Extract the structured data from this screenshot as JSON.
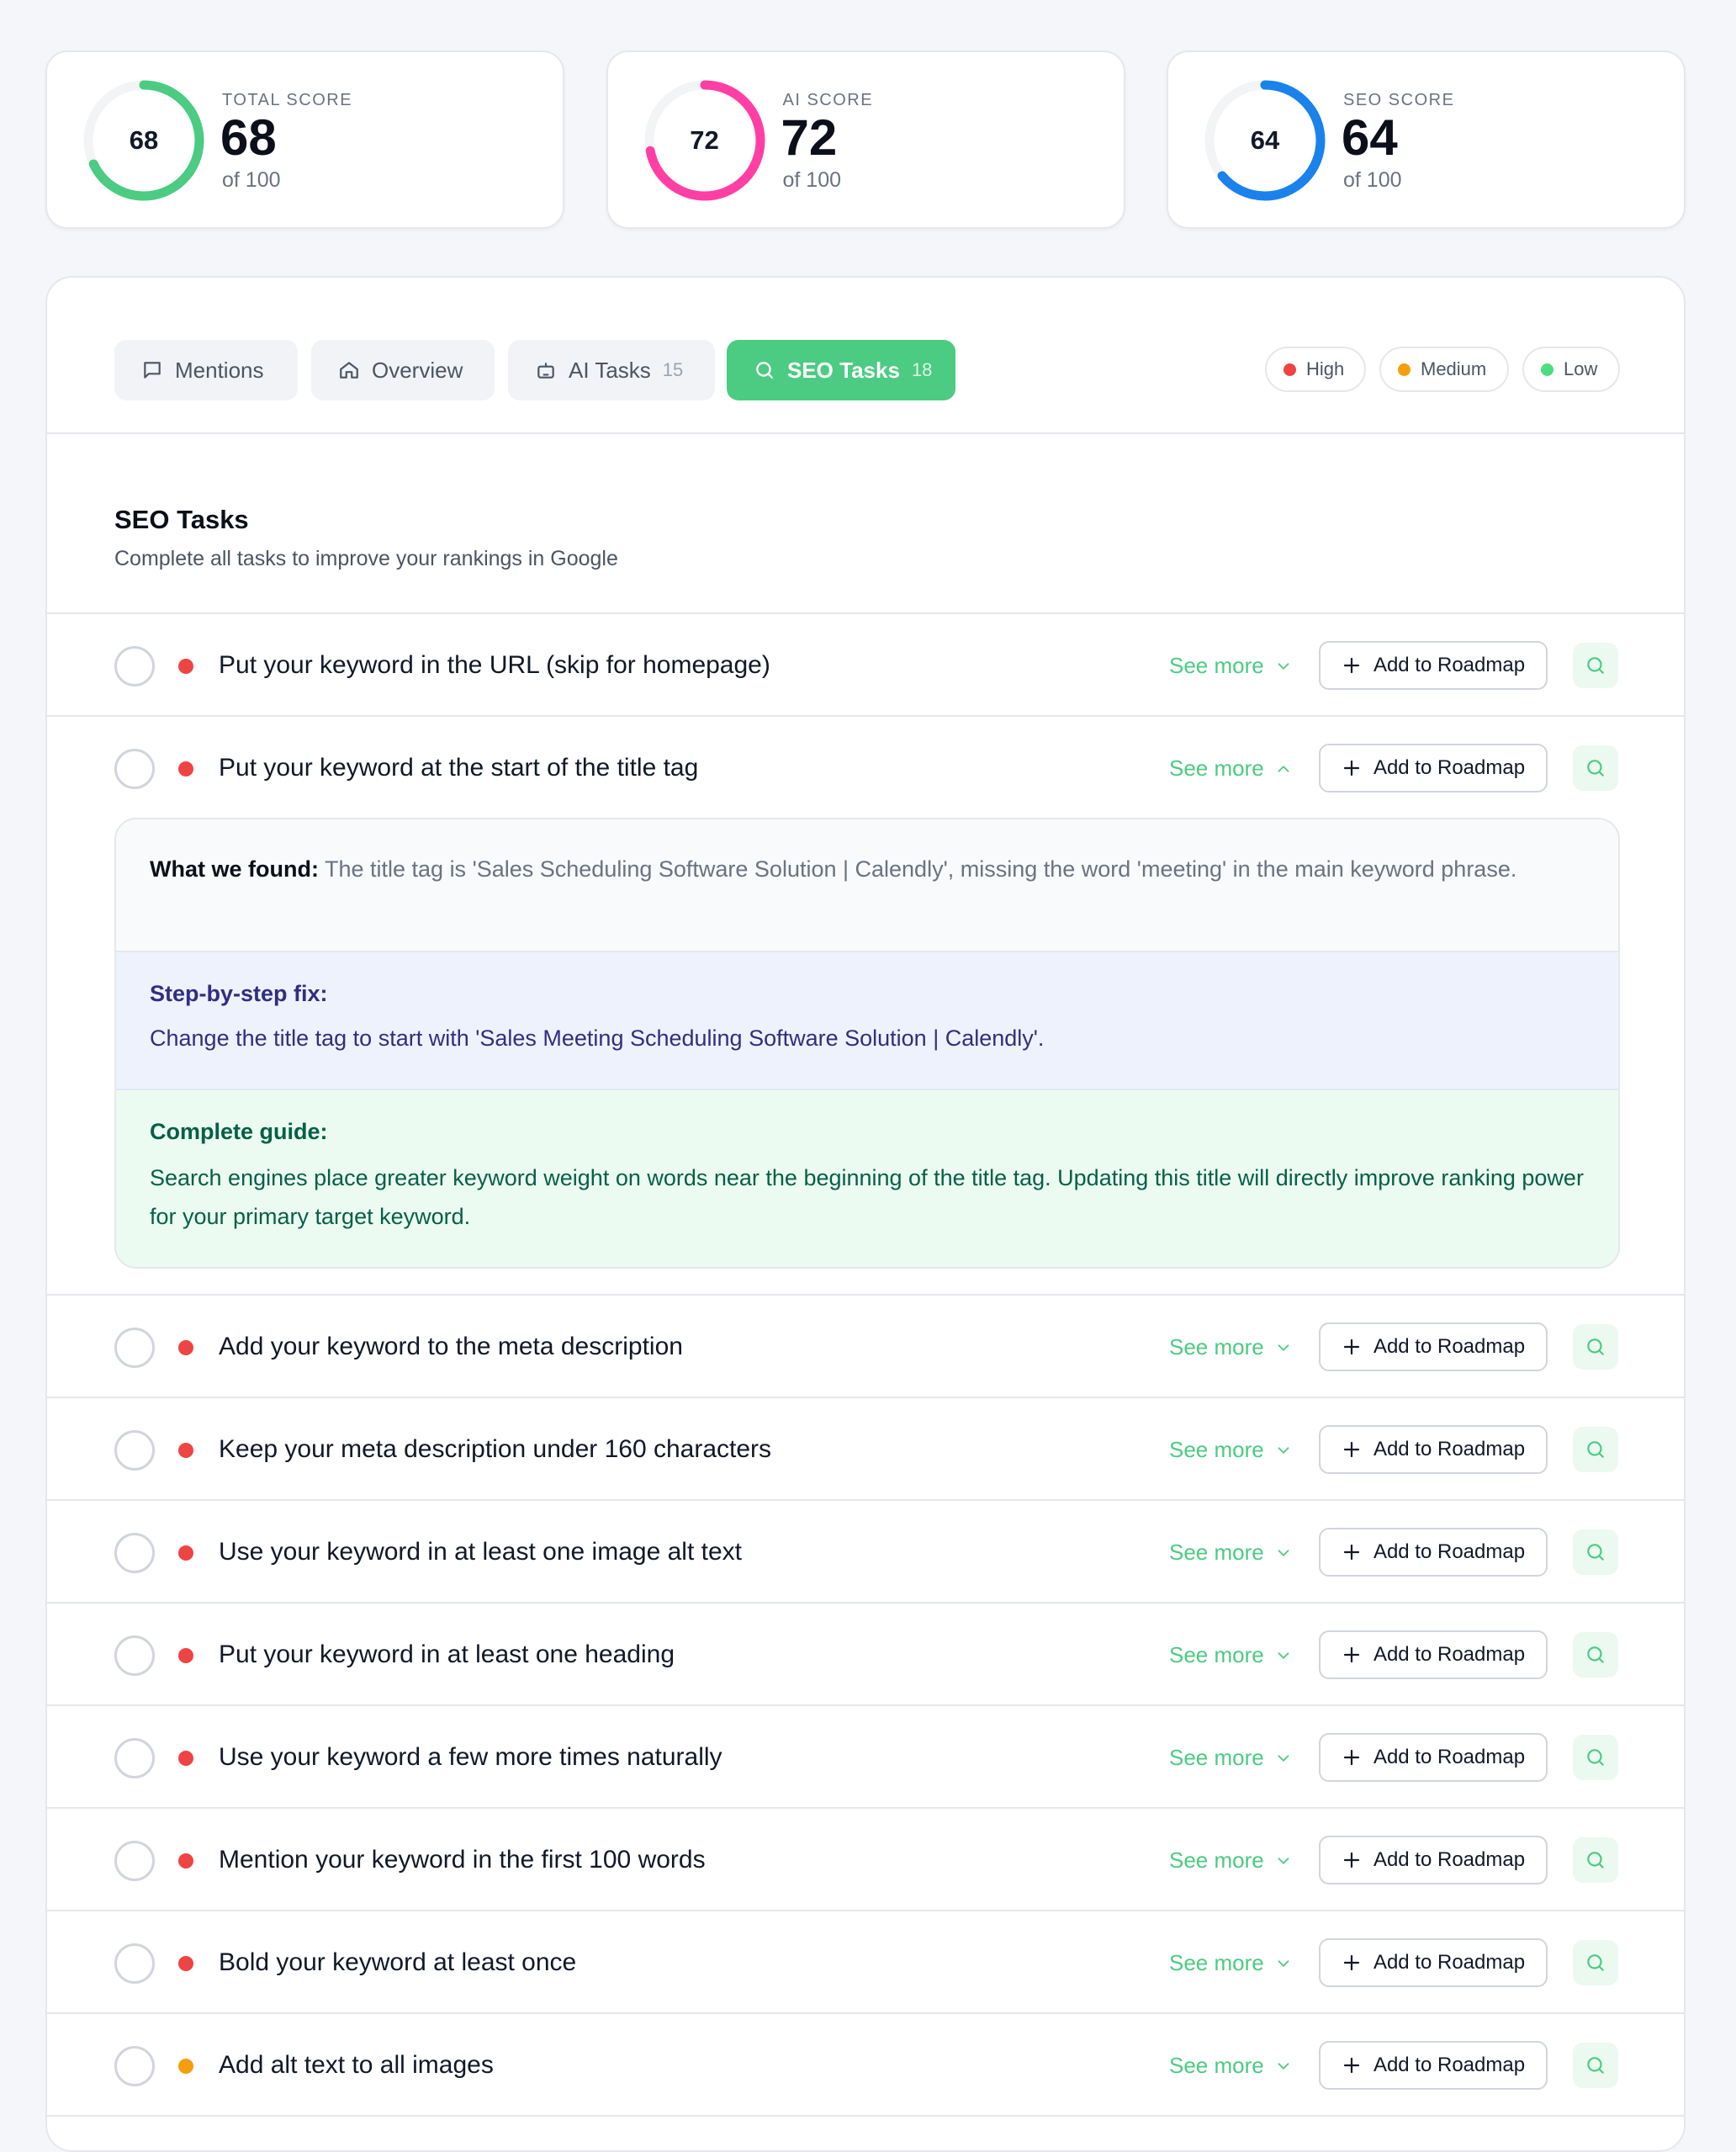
{
  "scores": [
    {
      "label": "TOTAL SCORE",
      "value": "68",
      "ring": "68",
      "of": "of 100",
      "pct": 68,
      "color": "#4ccb82"
    },
    {
      "label": "AI SCORE",
      "value": "72",
      "ring": "72",
      "of": "of 100",
      "pct": 72,
      "color": "#ff3fa4"
    },
    {
      "label": "SEO SCORE",
      "value": "64",
      "ring": "64",
      "of": "of 100",
      "pct": 64,
      "color": "#1a82ea"
    }
  ],
  "tabs": {
    "mentions": "Mentions",
    "overview": "Overview",
    "ai_tasks": "AI Tasks",
    "ai_tasks_count": "15",
    "seo_tasks": "SEO Tasks",
    "seo_tasks_count": "18"
  },
  "legend": {
    "high": "High",
    "medium": "Medium",
    "low": "Low"
  },
  "colors": {
    "high": "#ef4444",
    "medium": "#f59e0b",
    "low": "#4ade80",
    "accent": "#4ccb82"
  },
  "section": {
    "title": "SEO Tasks",
    "subtitle": "Complete all tasks to improve your rankings in Google"
  },
  "labels": {
    "see_more": "See more",
    "add_to_roadmap": "Add to Roadmap"
  },
  "tasks": [
    {
      "text": "Put your keyword in the URL (skip for homepage)",
      "priority": "high"
    },
    {
      "text": "Put your keyword at the start of the title tag",
      "priority": "high"
    },
    {
      "text": "Add your keyword to the meta description",
      "priority": "high"
    },
    {
      "text": "Keep your meta description under 160 characters",
      "priority": "high"
    },
    {
      "text": "Use your keyword in at least one image alt text",
      "priority": "high"
    },
    {
      "text": "Put your keyword in at least one heading",
      "priority": "high"
    },
    {
      "text": "Use your keyword a few more times naturally",
      "priority": "high"
    },
    {
      "text": "Mention your keyword in the first 100 words",
      "priority": "high"
    },
    {
      "text": "Bold your keyword at least once",
      "priority": "high"
    },
    {
      "text": "Add alt text to all images",
      "priority": "medium"
    }
  ],
  "details": {
    "found_label": "What we found:",
    "found_text": "The title tag is 'Sales Scheduling Software Solution | Calendly', missing the word 'meeting' in the main keyword phrase.",
    "steps_label": "Step-by-step fix:",
    "steps_text": "Change the title tag to start with 'Sales Meeting Scheduling Software Solution | Calendly'.",
    "guide_label": "Complete guide:",
    "guide_text": "Search engines place greater keyword weight on words near the beginning of the title tag. Updating this title will directly improve ranking power for your primary target keyword."
  }
}
